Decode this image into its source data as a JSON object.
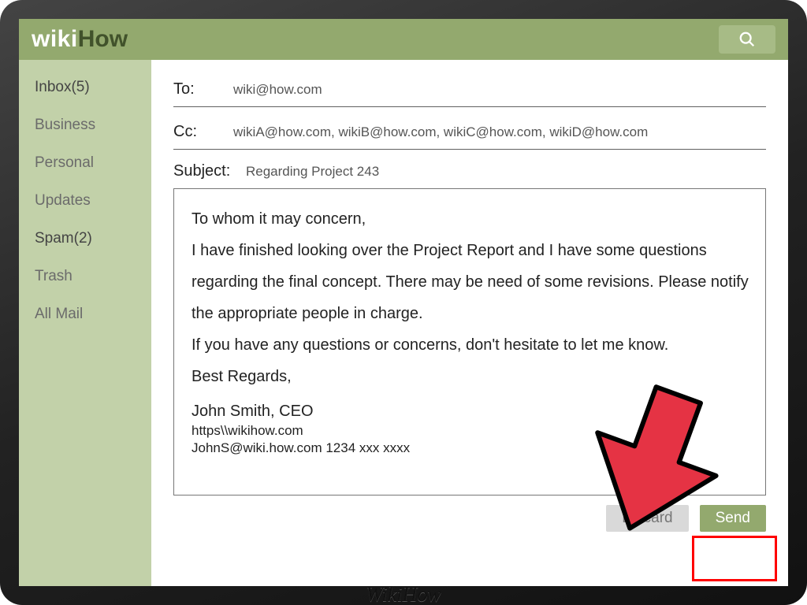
{
  "brand": {
    "part1": "wiki",
    "part2": "How"
  },
  "device_label": "WikiHow",
  "sidebar": {
    "items": [
      {
        "label": "Inbox(5)",
        "emphasis": true
      },
      {
        "label": "Business",
        "emphasis": false
      },
      {
        "label": "Personal",
        "emphasis": false
      },
      {
        "label": "Updates",
        "emphasis": false
      },
      {
        "label": "Spam(2)",
        "emphasis": true
      },
      {
        "label": "Trash",
        "emphasis": false
      },
      {
        "label": "All Mail",
        "emphasis": false
      }
    ]
  },
  "compose": {
    "to_label": "To:",
    "to_value": "wiki@how.com",
    "cc_label": "Cc:",
    "cc_value": "wikiA@how.com, wikiB@how.com, wikiC@how.com, wikiD@how.com",
    "subject_label": "Subject:",
    "subject_value": "Regarding Project 243",
    "body_lines": [
      "To whom it may concern,",
      "I have finished looking over the Project Report and I have some questions regarding the final concept. There may be need of some revisions. Please notify the appropriate people in charge.",
      "If you have any questions or concerns, don't hesitate to let me know.",
      "Best Regards,"
    ],
    "signature": {
      "name_line": "John Smith, CEO",
      "url_line": "https\\\\wikihow.com",
      "contact_line": "JohnS@wiki.how.com  1234 xxx xxxx"
    }
  },
  "actions": {
    "discard": "Discard",
    "send": "Send"
  },
  "colors": {
    "header": "#93a96e",
    "sidebar": "#c2d1a9",
    "accent": "#a7bb86",
    "highlight": "#ff0000",
    "arrow": "#e53344"
  }
}
